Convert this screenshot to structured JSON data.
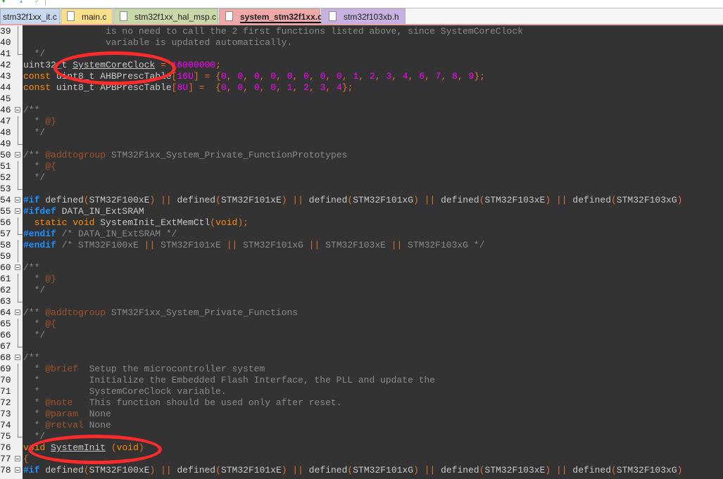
{
  "tabs": [
    {
      "label": "stm32f1xx_it.c",
      "color": "#c8d8f0",
      "active": false
    },
    {
      "label": "main.c",
      "color": "#ffe08a",
      "active": false
    },
    {
      "label": "stm32f1xx_hal_msp.c",
      "color": "#c8d8a8",
      "active": false
    },
    {
      "label": "system_stm32f1xx.c",
      "color": "#f0a8a8",
      "active": true
    },
    {
      "label": "stm32f103xb.h",
      "color": "#c8b0e0",
      "active": false
    }
  ],
  "lines": [
    {
      "n": "39",
      "text": "               is no need to call the 2 first functions listed above, since SystemCoreClock"
    },
    {
      "n": "40",
      "text": "               variable is updated automatically."
    },
    {
      "n": "41",
      "text": "  */"
    },
    {
      "n": "42",
      "text": "uint32_t SystemCoreClock = 16000000;"
    },
    {
      "n": "43",
      "text": "const uint8_t AHBPrescTable[16U] = {0, 0, 0, 0, 0, 0, 0, 0, 1, 2, 3, 4, 6, 7, 8, 9};"
    },
    {
      "n": "44",
      "text": "const uint8_t APBPrescTable[8U] =  {0, 0, 0, 0, 1, 2, 3, 4};"
    },
    {
      "n": "45",
      "text": ""
    },
    {
      "n": "46",
      "text": "/**"
    },
    {
      "n": "47",
      "text": "  * @}"
    },
    {
      "n": "48",
      "text": "  */"
    },
    {
      "n": "49",
      "text": ""
    },
    {
      "n": "50",
      "text": "/** @addtogroup STM32F1xx_System_Private_FunctionPrototypes"
    },
    {
      "n": "51",
      "text": "  * @{"
    },
    {
      "n": "52",
      "text": "  */"
    },
    {
      "n": "53",
      "text": ""
    },
    {
      "n": "54",
      "text": "#if defined(STM32F100xE) || defined(STM32F101xE) || defined(STM32F101xG) || defined(STM32F103xE) || defined(STM32F103xG)"
    },
    {
      "n": "55",
      "text": "#ifdef DATA_IN_ExtSRAM"
    },
    {
      "n": "56",
      "text": "  static void SystemInit_ExtMemCtl(void);"
    },
    {
      "n": "57",
      "text": "#endif /* DATA_IN_ExtSRAM */"
    },
    {
      "n": "58",
      "text": "#endif /* STM32F100xE || STM32F101xE || STM32F101xG || STM32F103xE || STM32F103xG */"
    },
    {
      "n": "59",
      "text": ""
    },
    {
      "n": "60",
      "text": "/**"
    },
    {
      "n": "61",
      "text": "  * @}"
    },
    {
      "n": "62",
      "text": "  */"
    },
    {
      "n": "63",
      "text": ""
    },
    {
      "n": "64",
      "text": "/** @addtogroup STM32F1xx_System_Private_Functions"
    },
    {
      "n": "65",
      "text": "  * @{"
    },
    {
      "n": "66",
      "text": "  */"
    },
    {
      "n": "67",
      "text": ""
    },
    {
      "n": "68",
      "text": "/**"
    },
    {
      "n": "69",
      "text": "  * @brief  Setup the microcontroller system"
    },
    {
      "n": "70",
      "text": "  *         Initialize the Embedded Flash Interface, the PLL and update the"
    },
    {
      "n": "71",
      "text": "  *         SystemCoreClock variable."
    },
    {
      "n": "72",
      "text": "  * @note   This function should be used only after reset."
    },
    {
      "n": "73",
      "text": "  * @param  None"
    },
    {
      "n": "74",
      "text": "  * @retval None"
    },
    {
      "n": "75",
      "text": "  */"
    },
    {
      "n": "76",
      "text": "void SystemInit (void)"
    },
    {
      "n": "77",
      "text": "{"
    },
    {
      "n": "78",
      "text": "#if defined(STM32F100xE) || defined(STM32F101xE) || defined(STM32F101xG) || defined(STM32F103xE) || defined(STM32F103xG)"
    }
  ],
  "annotations": [
    "SystemCoreClock",
    "SystemInit"
  ],
  "colors": {
    "annotation": "#ff2a2a",
    "editor_bg": "#333333"
  }
}
